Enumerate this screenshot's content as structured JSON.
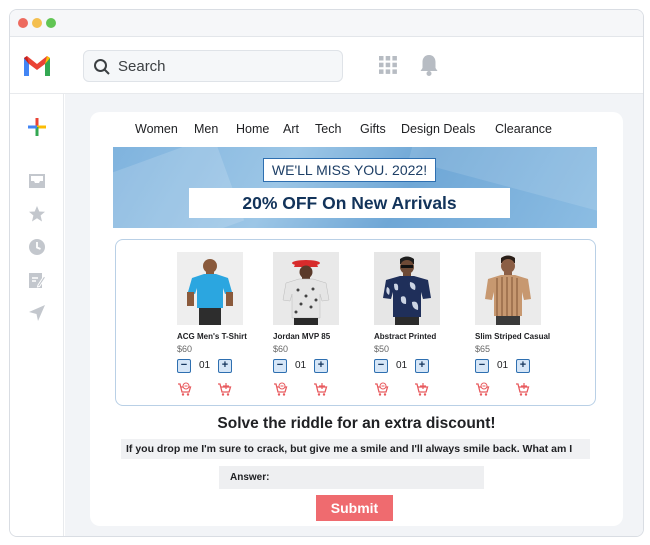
{
  "appbar": {
    "search_placeholder": "Search"
  },
  "nav": {
    "items": [
      "Women",
      "Men",
      "Home",
      "Art",
      "Tech",
      "Gifts",
      "Design Deals",
      "Clearance"
    ]
  },
  "banner": {
    "tag": "WE'LL MISS YOU. 2022!",
    "headline": "20% OFF On New Arrivals"
  },
  "products": [
    {
      "name": "ACG Men's T-Shirt",
      "price": "$60",
      "qty": "01"
    },
    {
      "name": "Jordan MVP 85",
      "price": "$60",
      "qty": "01"
    },
    {
      "name": "Abstract Printed",
      "price": "$50",
      "qty": "01"
    },
    {
      "name": "Slim Striped Casual",
      "price": "$65",
      "qty": "01"
    }
  ],
  "qty_controls": {
    "minus": "−",
    "plus": "+"
  },
  "riddle": {
    "title": "Solve the riddle for an extra discount!",
    "text": "If you drop me I'm sure to crack, but give me a smile and I'll always smile back. What am I",
    "answer_label": "Answer:",
    "submit_label": "Submit"
  },
  "colors": {
    "accent": "#2e6fb0",
    "submit": "#ef6b6f",
    "banner": "#8cbde3"
  },
  "icons": [
    "gmail-logo",
    "search-icon",
    "apps-grid-icon",
    "bell-icon",
    "compose-plus-icon",
    "inbox-icon",
    "star-icon",
    "clock-icon",
    "drafts-icon",
    "send-icon",
    "remove-from-cart-icon",
    "add-to-cart-icon"
  ]
}
